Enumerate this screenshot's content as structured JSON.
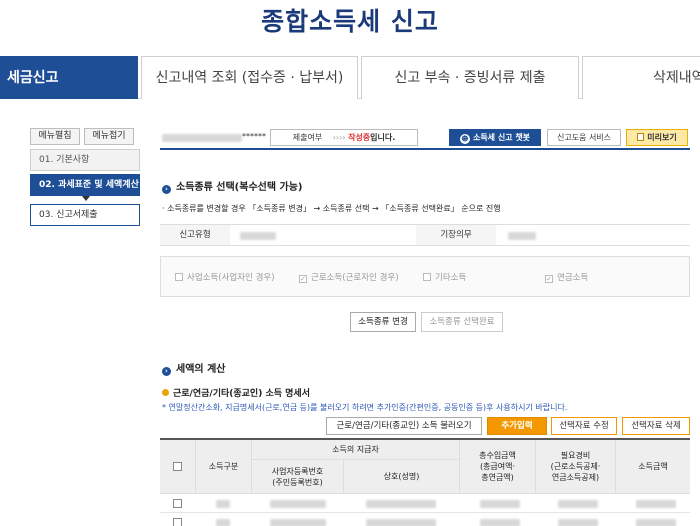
{
  "page": {
    "title": "종합소득세 신고"
  },
  "tabs": [
    {
      "label": "세금신고"
    },
    {
      "label": "신고내역 조회 (접수증 · 납부서)"
    },
    {
      "label": "신고 부속 · 증빙서류 제출"
    },
    {
      "label": "삭제내역"
    }
  ],
  "sidebar": {
    "menu_expand": "메뉴펼침",
    "menu_collapse": "메뉴접기",
    "steps": [
      {
        "label": "01. 기본사항"
      },
      {
        "label": "02. 과세표준 및 세액계산"
      },
      {
        "label": "03. 신고서제출"
      }
    ]
  },
  "topbar": {
    "user_masked": "******",
    "submit_label": "제출여부",
    "submit_arrows": "›››› ",
    "submit_status": "작성중",
    "submit_suffix": "입니다.",
    "chatbot_button": "소득세 신고 챗봇",
    "help_button": "신고도움 서비스",
    "preview_button": "미리보기"
  },
  "income_section": {
    "title": "소득종류 선택(복수선택 가능)",
    "info": "· 소득종류를 변경할 경우 「소득종류 변경」 → 소득종류 선택 → 「소득종류 선택완료」 순으로 진행",
    "filing_type_label": "신고유형",
    "bookkeeping_label": "기장의무",
    "options": [
      {
        "label": "사업소득(사업자인 경우)",
        "checked": false
      },
      {
        "label": "근로소득(근로자인 경우)",
        "checked": true
      },
      {
        "label": "기타소득",
        "checked": false
      },
      {
        "label": "연금소득",
        "checked": true
      }
    ],
    "change_button": "소득종류 변경",
    "complete_button": "소득종류 선택완료"
  },
  "tax_section": {
    "title": "세액의 계산",
    "subtitle": "근로/연금/기타(종교인) 소득 명세서",
    "note": "* 연말정산간소화, 지급명세서(근로,연금 등)를 불러오기 하려면 추가인증(간편인증, 공동인증 등)후 사용하시기 바랍니다.",
    "load_button": "근로/연금/기타(종교인) 소득 불러오기",
    "add_button": "추가입력",
    "edit_button": "선택자료 수정",
    "delete_button": "선택자료 삭제",
    "columns": {
      "income_type": "소득구분",
      "payer": "소득의 지급자",
      "bizno": "사업자등록번호\n(주민등록번호)",
      "name": "상호(성명)",
      "total": "총수입금액\n(총급여액·\n총연금액)",
      "expense": "필요경비\n(근로소득공제·\n연금소득공제)",
      "income": "소득금액"
    }
  },
  "colors": {
    "brand": "#1e4f96",
    "title": "#1b3a7a",
    "accent": "#f39800",
    "alert": "#d33333"
  }
}
